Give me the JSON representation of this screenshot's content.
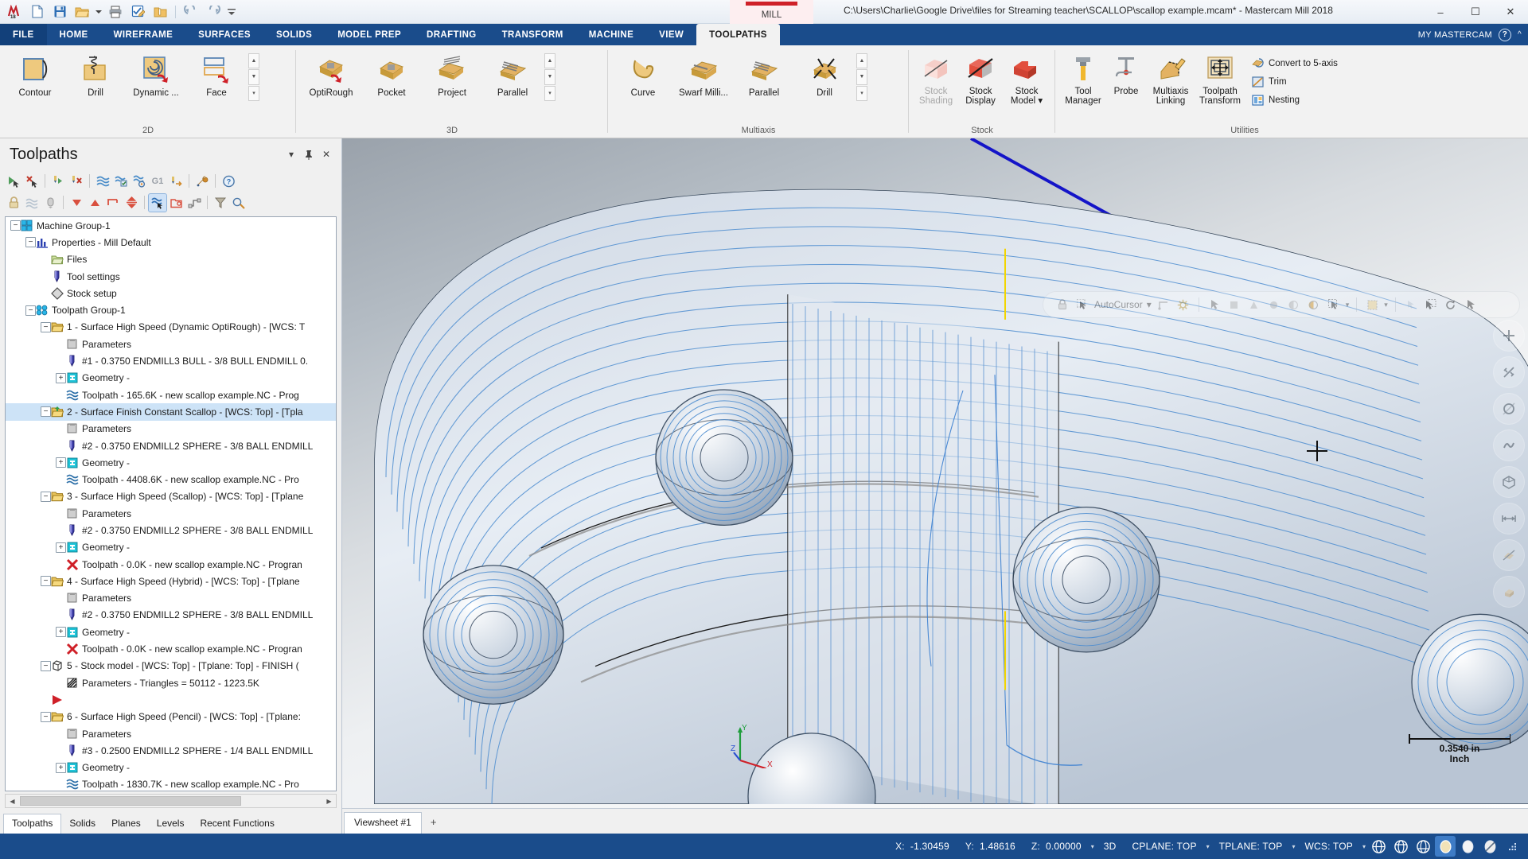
{
  "titlebar": {
    "quick_access": [
      {
        "name": "mastercam-logo-icon",
        "label": "M"
      },
      {
        "name": "new-file-icon",
        "label": "New"
      },
      {
        "name": "save-icon",
        "label": "Save"
      },
      {
        "name": "open-folder-icon",
        "label": "Open"
      },
      {
        "name": "open-dropdown-icon",
        "label": "Open options"
      },
      {
        "name": "print-icon",
        "label": "Print"
      },
      {
        "name": "edit-note-icon",
        "label": "Edit"
      },
      {
        "name": "zip-folder-icon",
        "label": "Zip2Go"
      },
      {
        "name": "undo-icon",
        "label": "Undo"
      },
      {
        "name": "redo-icon",
        "label": "Redo"
      },
      {
        "name": "customize-qat-icon",
        "label": "Customize"
      }
    ],
    "mill_tab": "MILL",
    "document_title": "C:\\Users\\Charlie\\Google Drive\\files for Streaming teacher\\SCALLOP\\scallop example.mcam* - Mastercam Mill 2018",
    "window_controls": {
      "minimize": "–",
      "maximize": "☐",
      "close": "✕"
    }
  },
  "ribbon": {
    "tabs": [
      {
        "label": "FILE",
        "active": false,
        "file": true
      },
      {
        "label": "HOME",
        "active": false
      },
      {
        "label": "WIREFRAME",
        "active": false
      },
      {
        "label": "SURFACES",
        "active": false
      },
      {
        "label": "SOLIDS",
        "active": false
      },
      {
        "label": "MODEL PREP",
        "active": false
      },
      {
        "label": "DRAFTING",
        "active": false
      },
      {
        "label": "TRANSFORM",
        "active": false
      },
      {
        "label": "MACHINE",
        "active": false
      },
      {
        "label": "VIEW",
        "active": false
      },
      {
        "label": "TOOLPATHS",
        "active": true
      }
    ],
    "my_mastercam": "MY MASTERCAM",
    "groups": [
      {
        "title": "2D",
        "buttons": [
          {
            "label": "Contour",
            "icon": "contour-icon"
          },
          {
            "label": "Drill",
            "icon": "drill-icon"
          },
          {
            "label": "Dynamic ...",
            "icon": "dynamic-mill-icon"
          },
          {
            "label": "Face",
            "icon": "face-icon"
          }
        ],
        "gallery_scroll": true
      },
      {
        "title": "3D",
        "buttons": [
          {
            "label": "OptiRough",
            "icon": "optirough-icon"
          },
          {
            "label": "Pocket",
            "icon": "pocket-icon"
          },
          {
            "label": "Project",
            "icon": "project-icon"
          },
          {
            "label": "Parallel",
            "icon": "parallel-3d-icon"
          }
        ],
        "gallery_scroll": true
      },
      {
        "title": "Multiaxis",
        "buttons": [
          {
            "label": "Curve",
            "icon": "curve-icon"
          },
          {
            "label": "Swarf Milli...",
            "icon": "swarf-mill-icon"
          },
          {
            "label": "Parallel",
            "icon": "parallel-multiaxis-icon"
          },
          {
            "label": "Drill",
            "icon": "multiaxis-drill-icon"
          }
        ],
        "gallery_scroll": true
      },
      {
        "title": "Stock",
        "buttons": [
          {
            "label": "Stock Shading",
            "icon": "stock-shading-icon",
            "disabled": true
          },
          {
            "label": "Stock Display",
            "icon": "stock-display-icon"
          },
          {
            "label": "Stock Model ▾",
            "icon": "stock-model-icon"
          }
        ]
      },
      {
        "title": "Utilities",
        "buttons": [
          {
            "label": "Tool Manager",
            "icon": "tool-manager-icon"
          },
          {
            "label": "Probe",
            "icon": "probe-icon"
          },
          {
            "label": "Multiaxis Linking",
            "icon": "multiaxis-linking-icon"
          },
          {
            "label": "Toolpath Transform",
            "icon": "toolpath-transform-icon"
          }
        ],
        "small_buttons": [
          {
            "label": "Convert to 5-axis",
            "icon": "convert-5axis-icon"
          },
          {
            "label": "Trim",
            "icon": "trim-icon"
          },
          {
            "label": "Nesting",
            "icon": "nesting-icon"
          }
        ]
      }
    ]
  },
  "toolpaths_panel": {
    "title": "Toolpaths",
    "header_buttons": [
      {
        "name": "panel-dropdown-icon",
        "label": "▾"
      },
      {
        "name": "panel-pin-icon",
        "label": "📌"
      },
      {
        "name": "panel-close-icon",
        "label": "✕"
      }
    ],
    "toolbar_row1": [
      {
        "name": "select-all-operations-icon"
      },
      {
        "name": "deselect-all-operations-icon"
      },
      {
        "name": "regenerate-selected-icon"
      },
      {
        "name": "regenerate-dirty-icon"
      },
      {
        "name": "backplot-icon"
      },
      {
        "name": "verify-icon"
      },
      {
        "name": "simulate-stock-icon"
      },
      {
        "name": "g1-post-icon",
        "label": "G1"
      },
      {
        "name": "high-speed-machine-icon"
      },
      {
        "name": "toolpath-settings-icon"
      },
      {
        "name": "help-icon"
      }
    ],
    "toolbar_row2": [
      {
        "name": "lock-icon"
      },
      {
        "name": "toggle-toolpath-display-icon"
      },
      {
        "name": "toggle-posting-icon"
      },
      {
        "name": "move-down-icon"
      },
      {
        "name": "move-up-icon"
      },
      {
        "name": "insert-arrow-icon"
      },
      {
        "name": "move-insert-arrow-icon"
      },
      {
        "name": "toolpath-display-on-icon",
        "active": true
      },
      {
        "name": "group-operations-icon"
      },
      {
        "name": "expand-tree-icon"
      },
      {
        "name": "filter-icon"
      },
      {
        "name": "paint-toolpath-icon"
      }
    ],
    "tree": [
      {
        "indent": 0,
        "icon": "machine-group-icon",
        "label": "Machine Group-1",
        "expander": "minus"
      },
      {
        "indent": 1,
        "icon": "properties-icon",
        "label": "Properties - Mill Default",
        "expander": "minus"
      },
      {
        "indent": 2,
        "icon": "files-folder-icon",
        "label": "Files",
        "expander": "none"
      },
      {
        "indent": 2,
        "icon": "tool-settings-icon",
        "label": "Tool settings",
        "expander": "none"
      },
      {
        "indent": 2,
        "icon": "stock-setup-icon",
        "label": "Stock setup",
        "expander": "none"
      },
      {
        "indent": 1,
        "icon": "toolpath-group-icon",
        "label": "Toolpath Group-1",
        "expander": "minus"
      },
      {
        "indent": 2,
        "icon": "operation-folder-icon",
        "label": "1 - Surface High Speed (Dynamic OptiRough) - [WCS: T",
        "expander": "minus"
      },
      {
        "indent": 3,
        "icon": "parameters-icon",
        "label": "Parameters",
        "expander": "none"
      },
      {
        "indent": 3,
        "icon": "tool-icon",
        "label": "#1 - 0.3750 ENDMILL3 BULL - 3/8 BULL ENDMILL 0.",
        "expander": "none"
      },
      {
        "indent": 3,
        "icon": "geometry-icon",
        "label": "Geometry -",
        "expander": "plus"
      },
      {
        "indent": 3,
        "icon": "toolpath-ok-icon",
        "label": "Toolpath - 165.6K - new scallop example.NC - Prog",
        "expander": "none"
      },
      {
        "indent": 2,
        "icon": "operation-folder-selected-icon",
        "label": "2 - Surface Finish Constant Scallop - [WCS: Top] - [Tpla",
        "expander": "minus",
        "selected": true
      },
      {
        "indent": 3,
        "icon": "parameters-icon",
        "label": "Parameters",
        "expander": "none"
      },
      {
        "indent": 3,
        "icon": "tool-icon",
        "label": "#2 - 0.3750 ENDMILL2 SPHERE - 3/8 BALL ENDMILL",
        "expander": "none"
      },
      {
        "indent": 3,
        "icon": "geometry-icon",
        "label": "Geometry -",
        "expander": "plus"
      },
      {
        "indent": 3,
        "icon": "toolpath-ok-icon",
        "label": "Toolpath - 4408.6K - new scallop example.NC - Pro",
        "expander": "none"
      },
      {
        "indent": 2,
        "icon": "operation-folder-icon",
        "label": "3 - Surface High Speed (Scallop) - [WCS: Top] - [Tplane",
        "expander": "minus"
      },
      {
        "indent": 3,
        "icon": "parameters-icon",
        "label": "Parameters",
        "expander": "none"
      },
      {
        "indent": 3,
        "icon": "tool-icon",
        "label": "#2 - 0.3750 ENDMILL2 SPHERE - 3/8 BALL ENDMILL",
        "expander": "none"
      },
      {
        "indent": 3,
        "icon": "geometry-icon",
        "label": "Geometry -",
        "expander": "plus"
      },
      {
        "indent": 3,
        "icon": "toolpath-invalid-icon",
        "label": "Toolpath - 0.0K - new scallop example.NC - Progran",
        "expander": "none"
      },
      {
        "indent": 2,
        "icon": "operation-folder-icon",
        "label": "4 - Surface High Speed (Hybrid) - [WCS: Top] - [Tplane",
        "expander": "minus"
      },
      {
        "indent": 3,
        "icon": "parameters-icon",
        "label": "Parameters",
        "expander": "none"
      },
      {
        "indent": 3,
        "icon": "tool-icon",
        "label": "#2 - 0.3750 ENDMILL2 SPHERE - 3/8 BALL ENDMILL",
        "expander": "none"
      },
      {
        "indent": 3,
        "icon": "geometry-icon",
        "label": "Geometry -",
        "expander": "plus"
      },
      {
        "indent": 3,
        "icon": "toolpath-invalid-icon",
        "label": "Toolpath - 0.0K - new scallop example.NC - Progran",
        "expander": "none"
      },
      {
        "indent": 2,
        "icon": "stock-model-tree-icon",
        "label": "5 - Stock model - [WCS: Top] - [Tplane: Top] - FINISH (",
        "expander": "minus"
      },
      {
        "indent": 3,
        "icon": "stock-parameters-icon",
        "label": "Parameters - Triangles =  50112 - 1223.5K",
        "expander": "none"
      },
      {
        "indent": 2,
        "icon": "insert-arrow-red-icon",
        "label": "",
        "expander": "none"
      },
      {
        "indent": 2,
        "icon": "operation-folder-icon",
        "label": "6 - Surface High Speed (Pencil) - [WCS: Top] - [Tplane:",
        "expander": "minus"
      },
      {
        "indent": 3,
        "icon": "parameters-icon",
        "label": "Parameters",
        "expander": "none"
      },
      {
        "indent": 3,
        "icon": "tool-icon",
        "label": "#3 - 0.2500 ENDMILL2 SPHERE - 1/4 BALL ENDMILL",
        "expander": "none"
      },
      {
        "indent": 3,
        "icon": "geometry-icon",
        "label": "Geometry -",
        "expander": "plus"
      },
      {
        "indent": 3,
        "icon": "toolpath-ok-icon",
        "label": "Toolpath - 1830.7K - new scallop example.NC - Pro",
        "expander": "none"
      }
    ],
    "tabs": [
      {
        "label": "Toolpaths",
        "active": true
      },
      {
        "label": "Solids",
        "active": false
      },
      {
        "label": "Planes",
        "active": false
      },
      {
        "label": "Levels",
        "active": false
      },
      {
        "label": "Recent Functions",
        "active": false
      }
    ]
  },
  "viewport": {
    "autocursor": {
      "lock_icon": "autocursor-lock-icon",
      "label": "AutoCursor",
      "caret": "▾",
      "icons": [
        "autocursor-origin-icon",
        "autocursor-gear-icon",
        "autocursor-arrow-icon",
        "autocursor-endpoint-icon",
        "autocursor-midpoint-icon",
        "autocursor-center-icon",
        "autocursor-intersect-icon",
        "autocursor-quadrant-icon",
        "autocursor-point-icon",
        "autocursor-select-icon",
        "autocursor-window-icon",
        "autocursor-solid-face-icon",
        "autocursor-rotate-icon",
        "autocursor-pick-icon"
      ]
    },
    "right_toolbar": [
      "fit-screen-icon",
      "dynamic-rotate-icon",
      "zoom-window-icon",
      "unzoom-icon",
      "isometric-view-icon",
      "top-view-icon",
      "front-view-icon",
      "right-view-icon"
    ],
    "axis_labels": {
      "x": "X",
      "y": "Y",
      "z": "Z"
    },
    "scale": {
      "value": "0.3540 in",
      "unit": "Inch"
    },
    "viewsheet_tab": "Viewsheet #1",
    "viewsheet_add": "+"
  },
  "statusbar": {
    "x_label": "X:",
    "x_value": "-1.30459",
    "y_label": "Y:",
    "y_value": "1.48616",
    "z_label": "Z:",
    "z_value": "0.00000",
    "mode": "3D",
    "cplane": "CPLANE: TOP",
    "tplane": "TPLANE: TOP",
    "wcs": "WCS: TOP",
    "icons": [
      {
        "name": "wireframe-display-icon",
        "active": false
      },
      {
        "name": "hidden-line-display-icon",
        "active": false
      },
      {
        "name": "no-hidden-display-icon",
        "active": false
      },
      {
        "name": "shaded-display-icon",
        "active": true
      },
      {
        "name": "shaded-solid-icon",
        "active": false
      },
      {
        "name": "translucent-display-icon",
        "active": false
      },
      {
        "name": "resize-grip-icon",
        "active": false
      }
    ]
  }
}
